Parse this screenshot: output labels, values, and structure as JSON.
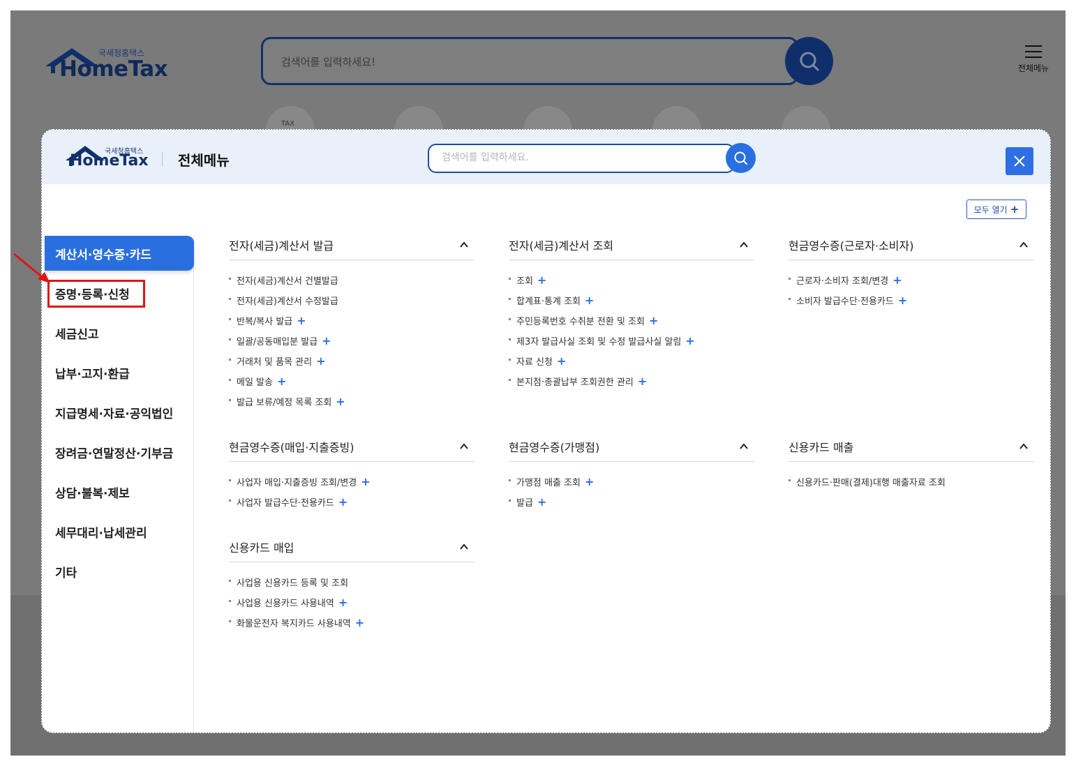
{
  "background": {
    "logo_sub": "국세청홈택스",
    "logo_name": "HomeTax",
    "search_placeholder": "검색어를 입력하세요!",
    "menu_label": "전체메뉴",
    "icon_tax": "TAX"
  },
  "modal": {
    "logo_sub": "국세청홈택스",
    "logo_name": "HomeTax",
    "title": "전체메뉴",
    "search_placeholder": "검색어를 입력하세요.",
    "open_all_label": "모두 열기"
  },
  "sidebar": {
    "items": [
      {
        "label": "계산서·영수증·카드",
        "active": true
      },
      {
        "label": "증명·등록·신청",
        "active": false
      },
      {
        "label": "세금신고",
        "active": false
      },
      {
        "label": "납부·고지·환급",
        "active": false
      },
      {
        "label": "지급명세·자료·공익법인",
        "active": false
      },
      {
        "label": "장려금·연말정산·기부금",
        "active": false
      },
      {
        "label": "상담·불복·제보",
        "active": false
      },
      {
        "label": "세무대리·납세관리",
        "active": false
      },
      {
        "label": "기타",
        "active": false
      }
    ]
  },
  "sections": [
    {
      "title": "전자(세금)계산서 발급",
      "items": [
        {
          "label": "전자(세금)계산서 건별발급",
          "plus": false
        },
        {
          "label": "전자(세금)계산서 수정발급",
          "plus": false
        },
        {
          "label": "반복/복사 발급",
          "plus": true
        },
        {
          "label": "일괄/공동매입분 발급",
          "plus": true
        },
        {
          "label": "거래처 및 품목 관리",
          "plus": true
        },
        {
          "label": "메일 발송",
          "plus": true
        },
        {
          "label": "발급 보류/예정 목록 조회",
          "plus": true
        }
      ]
    },
    {
      "title": "전자(세금)계산서 조회",
      "items": [
        {
          "label": "조회",
          "plus": true
        },
        {
          "label": "합계표·통계 조회",
          "plus": true
        },
        {
          "label": "주민등록번호 수취분 전환 및 조회",
          "plus": true
        },
        {
          "label": "제3자 발급사실 조회 및 수정 발급사실 알림",
          "plus": true
        },
        {
          "label": "자료 신청",
          "plus": true
        },
        {
          "label": "본지점·총괄납부 조회권한 관리",
          "plus": true
        }
      ]
    },
    {
      "title": "현금영수증(근로자·소비자)",
      "items": [
        {
          "label": "근로자·소비자 조회/변경",
          "plus": true
        },
        {
          "label": "소비자 발급수단·전용카드",
          "plus": true
        }
      ]
    },
    {
      "title": "현금영수증(매입·지출증빙)",
      "items": [
        {
          "label": "사업자 매입·지출증빙 조회/변경",
          "plus": true
        },
        {
          "label": "사업자 발급수단·전용카드",
          "plus": true
        }
      ]
    },
    {
      "title": "현금영수증(가맹점)",
      "items": [
        {
          "label": "가맹점 매출 조회",
          "plus": true
        },
        {
          "label": "발급",
          "plus": true
        }
      ]
    },
    {
      "title": "신용카드 매출",
      "items": [
        {
          "label": "신용카드·판매(결제)대행 매출자료 조회",
          "plus": false
        }
      ]
    },
    {
      "title": "신용카드 매입",
      "items": [
        {
          "label": "사업용 신용카드 등록 및 조회",
          "plus": false
        },
        {
          "label": "사업용 신용카드 사용내역",
          "plus": true
        },
        {
          "label": "화물운전자 복지카드 사용내역",
          "plus": true
        }
      ]
    }
  ],
  "colors": {
    "accent": "#2a6fe0",
    "navy": "#102f6a",
    "highlight": "#e01414"
  }
}
